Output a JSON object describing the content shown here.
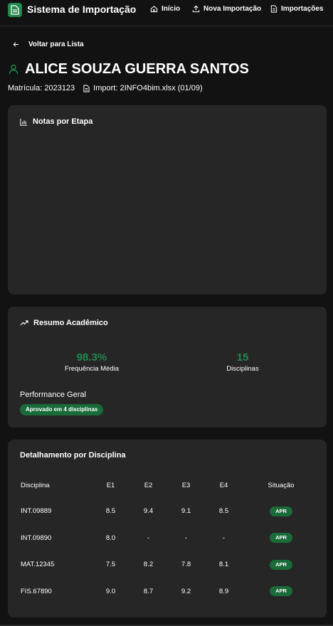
{
  "header": {
    "app_title": "Sistema de Importação",
    "logo_icon": "document-icon",
    "nav": [
      {
        "label": "Início",
        "icon": "home-icon"
      },
      {
        "label": "Nova Importação",
        "icon": "upload-icon"
      },
      {
        "label": "Importações",
        "icon": "file-list-icon"
      }
    ]
  },
  "back_link": {
    "label": "Voltar para Lista",
    "icon": "arrow-left-icon"
  },
  "student": {
    "name": "ALICE SOUZA GUERRA SANTOS",
    "matricula": "Matrícula: 2023123",
    "import_file": "Import: 2INFO4bim.xlsx (01/09)"
  },
  "notas_card": {
    "title": "Notas por Etapa",
    "icon": "bar-chart-icon"
  },
  "resumo_card": {
    "title": "Resumo Acadêmico",
    "icon": "trending-up-icon",
    "frequencia_value": "98.3%",
    "frequencia_label": "Frequência Média",
    "disciplinas_value": "15",
    "disciplinas_label": "Disciplinas",
    "performance_label": "Performance Geral",
    "performance_badge": "Aprovado em 4 disciplinas"
  },
  "detalhe_card": {
    "title": "Detalhamento por Disciplina",
    "columns": [
      "Disciplina",
      "E1",
      "E2",
      "E3",
      "E4",
      "Situação"
    ],
    "rows": [
      {
        "disciplina": "INT.09889",
        "e1": "8.5",
        "e2": "9.4",
        "e3": "9.1",
        "e4": "8.5",
        "situacao": "APR"
      },
      {
        "disciplina": "INT.09890",
        "e1": "8.0",
        "e2": "-",
        "e3": "-",
        "e4": "-",
        "situacao": "APR"
      },
      {
        "disciplina": "MAT.12345",
        "e1": "7.5",
        "e2": "8.2",
        "e3": "7.8",
        "e4": "8.1",
        "situacao": "APR"
      },
      {
        "disciplina": "FIS.67890",
        "e1": "9.0",
        "e2": "8.7",
        "e3": "9.2",
        "e4": "8.9",
        "situacao": "APR"
      }
    ]
  },
  "colors": {
    "accent": "#1f8a4c",
    "badge": "#1a6b3a",
    "card": "#262626",
    "background": "#121212"
  }
}
